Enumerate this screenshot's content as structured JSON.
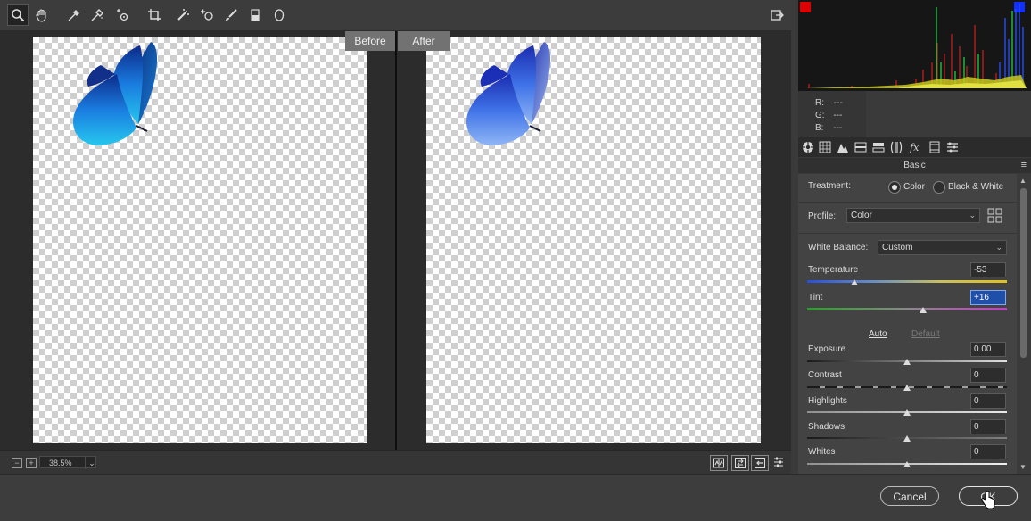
{
  "toolbar": {
    "tools": [
      "zoom-icon",
      "hand-icon",
      "white-balance-icon",
      "color-sampler-icon",
      "targeted-adjustment-icon",
      "crop-icon",
      "spot-removal-icon",
      "red-eye-icon",
      "adjustment-brush-icon",
      "graduated-filter-icon",
      "radial-filter-icon"
    ],
    "export_icon": "export-icon"
  },
  "preview": {
    "before_label": "Before",
    "after_label": "After"
  },
  "bottom": {
    "zoom_out": "−",
    "zoom_in": "+",
    "zoom_value": "38.5%",
    "zoom_caret": "⌄"
  },
  "histogram": {
    "shadow_clip_color": "#e00000",
    "highlight_clip_color": "#1030ff"
  },
  "readout": {
    "r_label": "R:",
    "r_value": "---",
    "g_label": "G:",
    "g_value": "---",
    "b_label": "B:",
    "b_value": "---"
  },
  "panel": {
    "section_title": "Basic",
    "treatment_label": "Treatment:",
    "treatment_color": "Color",
    "treatment_bw": "Black & White",
    "treatment_selected": "Color",
    "profile_label": "Profile:",
    "profile_value": "Color",
    "wb_label": "White Balance:",
    "wb_value": "Custom",
    "temperature": {
      "label": "Temperature",
      "value": "-53",
      "level": -53
    },
    "tint": {
      "label": "Tint",
      "value": "+16",
      "level": 16
    },
    "auto_label": "Auto",
    "default_label": "Default",
    "sliders": [
      {
        "label": "Exposure",
        "value": "0.00"
      },
      {
        "label": "Contrast",
        "value": "0"
      },
      {
        "label": "Highlights",
        "value": "0"
      },
      {
        "label": "Shadows",
        "value": "0"
      },
      {
        "label": "Whites",
        "value": "0"
      }
    ]
  },
  "footer": {
    "cancel_label": "Cancel",
    "ok_label": "OK"
  }
}
